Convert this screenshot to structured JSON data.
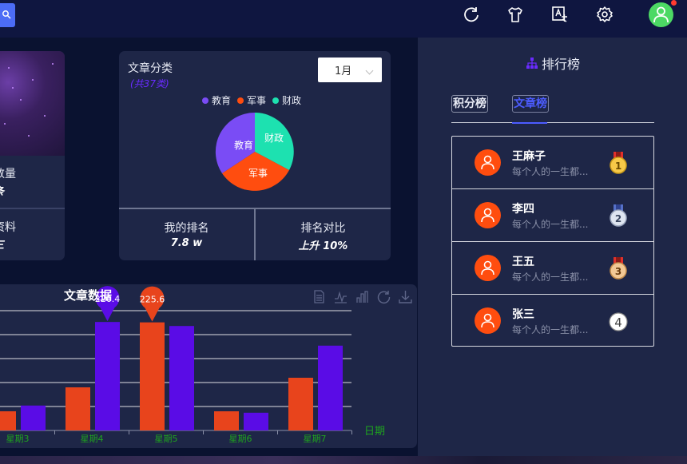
{
  "topbar": {
    "icons": [
      "refresh-icon",
      "shirt-icon",
      "translate-icon",
      "gear-icon",
      "user-avatar-icon"
    ],
    "colors": {
      "background": "#0f1640",
      "avatar": "#4cd964"
    }
  },
  "left_card": {
    "count_label": "数量",
    "count_value": "条",
    "profile_label": "资料",
    "profile_value": "三"
  },
  "category_card": {
    "title": "文章分类",
    "subtitle": "(共37类)",
    "month_selected": "1月",
    "legend": [
      {
        "label": "教育",
        "color": "#7a4cf5"
      },
      {
        "label": "军事",
        "color": "#ff4d0f"
      },
      {
        "label": "财政",
        "color": "#1de1b0"
      }
    ],
    "pie_labels": {
      "education": "教育",
      "military": "军事",
      "finance": "财政"
    },
    "stats": {
      "my_rank_label": "我的排名",
      "my_rank_value": "7.8 w",
      "rank_compare_label": "排名对比",
      "rank_compare_value": "上升 10%"
    }
  },
  "chart_card": {
    "title": "文章数据",
    "x_axis_name": "日期",
    "tool_icons": [
      "document-icon",
      "line-chart-icon",
      "bar-chart-icon",
      "refresh-icon",
      "download-icon"
    ]
  },
  "chart_data": {
    "type": "bar",
    "categories": [
      "星期3",
      "星期4",
      "星期5",
      "星期6",
      "星期7"
    ],
    "xlabel": "日期",
    "series": [
      {
        "color": "#e8441c",
        "values": [
          40,
          90,
          225.6,
          40,
          110
        ]
      },
      {
        "color": "#5a0ce6",
        "values": [
          52,
          226.4,
          218,
          37,
          177
        ]
      }
    ],
    "annotations": [
      {
        "category": "星期4",
        "series_index": 1,
        "label": "226.4"
      },
      {
        "category": "星期5",
        "series_index": 0,
        "label": "225.6"
      }
    ],
    "ylim": [
      0,
      250
    ],
    "grid": true
  },
  "rank_panel": {
    "title": "排行榜",
    "tabs": [
      {
        "label": "积分榜",
        "active": false
      },
      {
        "label": "文章榜",
        "active": true
      }
    ],
    "entries": [
      {
        "name": "王麻子",
        "desc": "每个人的一生都...",
        "rank": "1",
        "medal": "gold"
      },
      {
        "name": "李四",
        "desc": "每个人的一生都...",
        "rank": "2",
        "medal": "silver"
      },
      {
        "name": "王五",
        "desc": "每个人的一生都...",
        "rank": "3",
        "medal": "bronze"
      },
      {
        "name": "张三",
        "desc": "每个人的一生都...",
        "rank": "4",
        "medal": "none"
      }
    ],
    "colors": {
      "accent": "#4c5cff",
      "avatar": "#ff4d0f"
    }
  }
}
